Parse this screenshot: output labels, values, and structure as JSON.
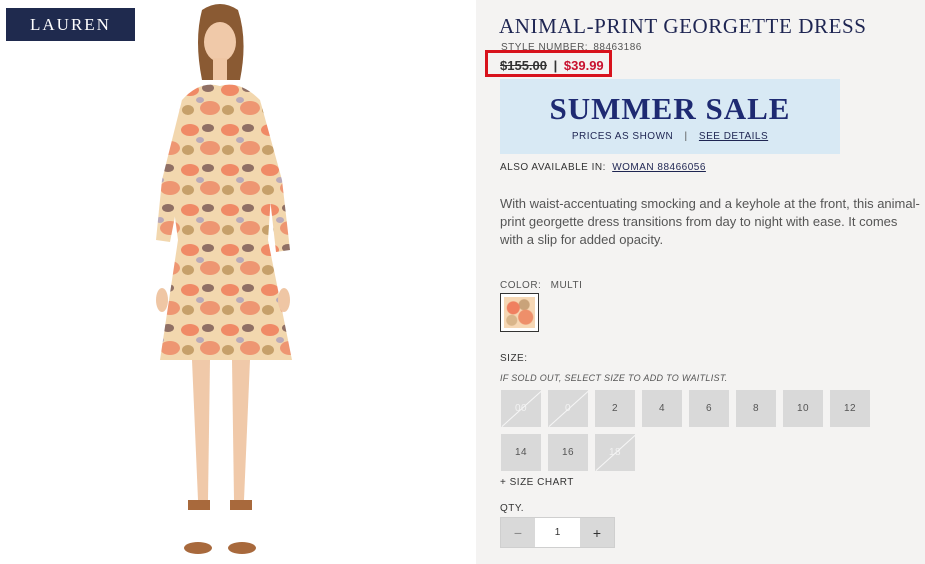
{
  "brand": {
    "logo_text": "LAUREN"
  },
  "product": {
    "title": "ANIMAL-PRINT GEORGETTE DRESS",
    "style_label": "STYLE NUMBER:",
    "style_number": "88463186",
    "price_old": "$155.00",
    "price_sep": "|",
    "price_new": "$39.99",
    "description": "With waist-accentuating smocking and a keyhole at the front, this animal-print georgette dress transitions from day to night with ease. It comes with a slip for added opacity."
  },
  "promo": {
    "title": "SUMMER SALE",
    "subtitle": "PRICES AS SHOWN",
    "separator": "|",
    "link": "SEE DETAILS"
  },
  "also_available": {
    "label": "ALSO AVAILABLE IN:",
    "link": "WOMAN 88466056"
  },
  "color": {
    "label": "COLOR:",
    "value": "MULTI"
  },
  "size": {
    "label": "SIZE:",
    "note": "IF SOLD OUT, SELECT SIZE TO ADD TO WAITLIST.",
    "options": [
      {
        "label": "00",
        "soldout": true
      },
      {
        "label": "0",
        "soldout": true
      },
      {
        "label": "2",
        "soldout": false
      },
      {
        "label": "4",
        "soldout": false
      },
      {
        "label": "6",
        "soldout": false
      },
      {
        "label": "8",
        "soldout": false
      },
      {
        "label": "10",
        "soldout": false
      },
      {
        "label": "12",
        "soldout": false
      },
      {
        "label": "14",
        "soldout": false
      },
      {
        "label": "16",
        "soldout": false
      },
      {
        "label": "18",
        "soldout": true
      }
    ],
    "chart_link": "+ SIZE CHART"
  },
  "quantity": {
    "label": "QTY.",
    "decrement": "−",
    "value": "1",
    "increment": "+"
  },
  "colors": {
    "accent": "#1e2552",
    "sale_red": "#c8102e",
    "highlight_box": "#d8121c",
    "promo_bg": "#d8e9f4"
  }
}
